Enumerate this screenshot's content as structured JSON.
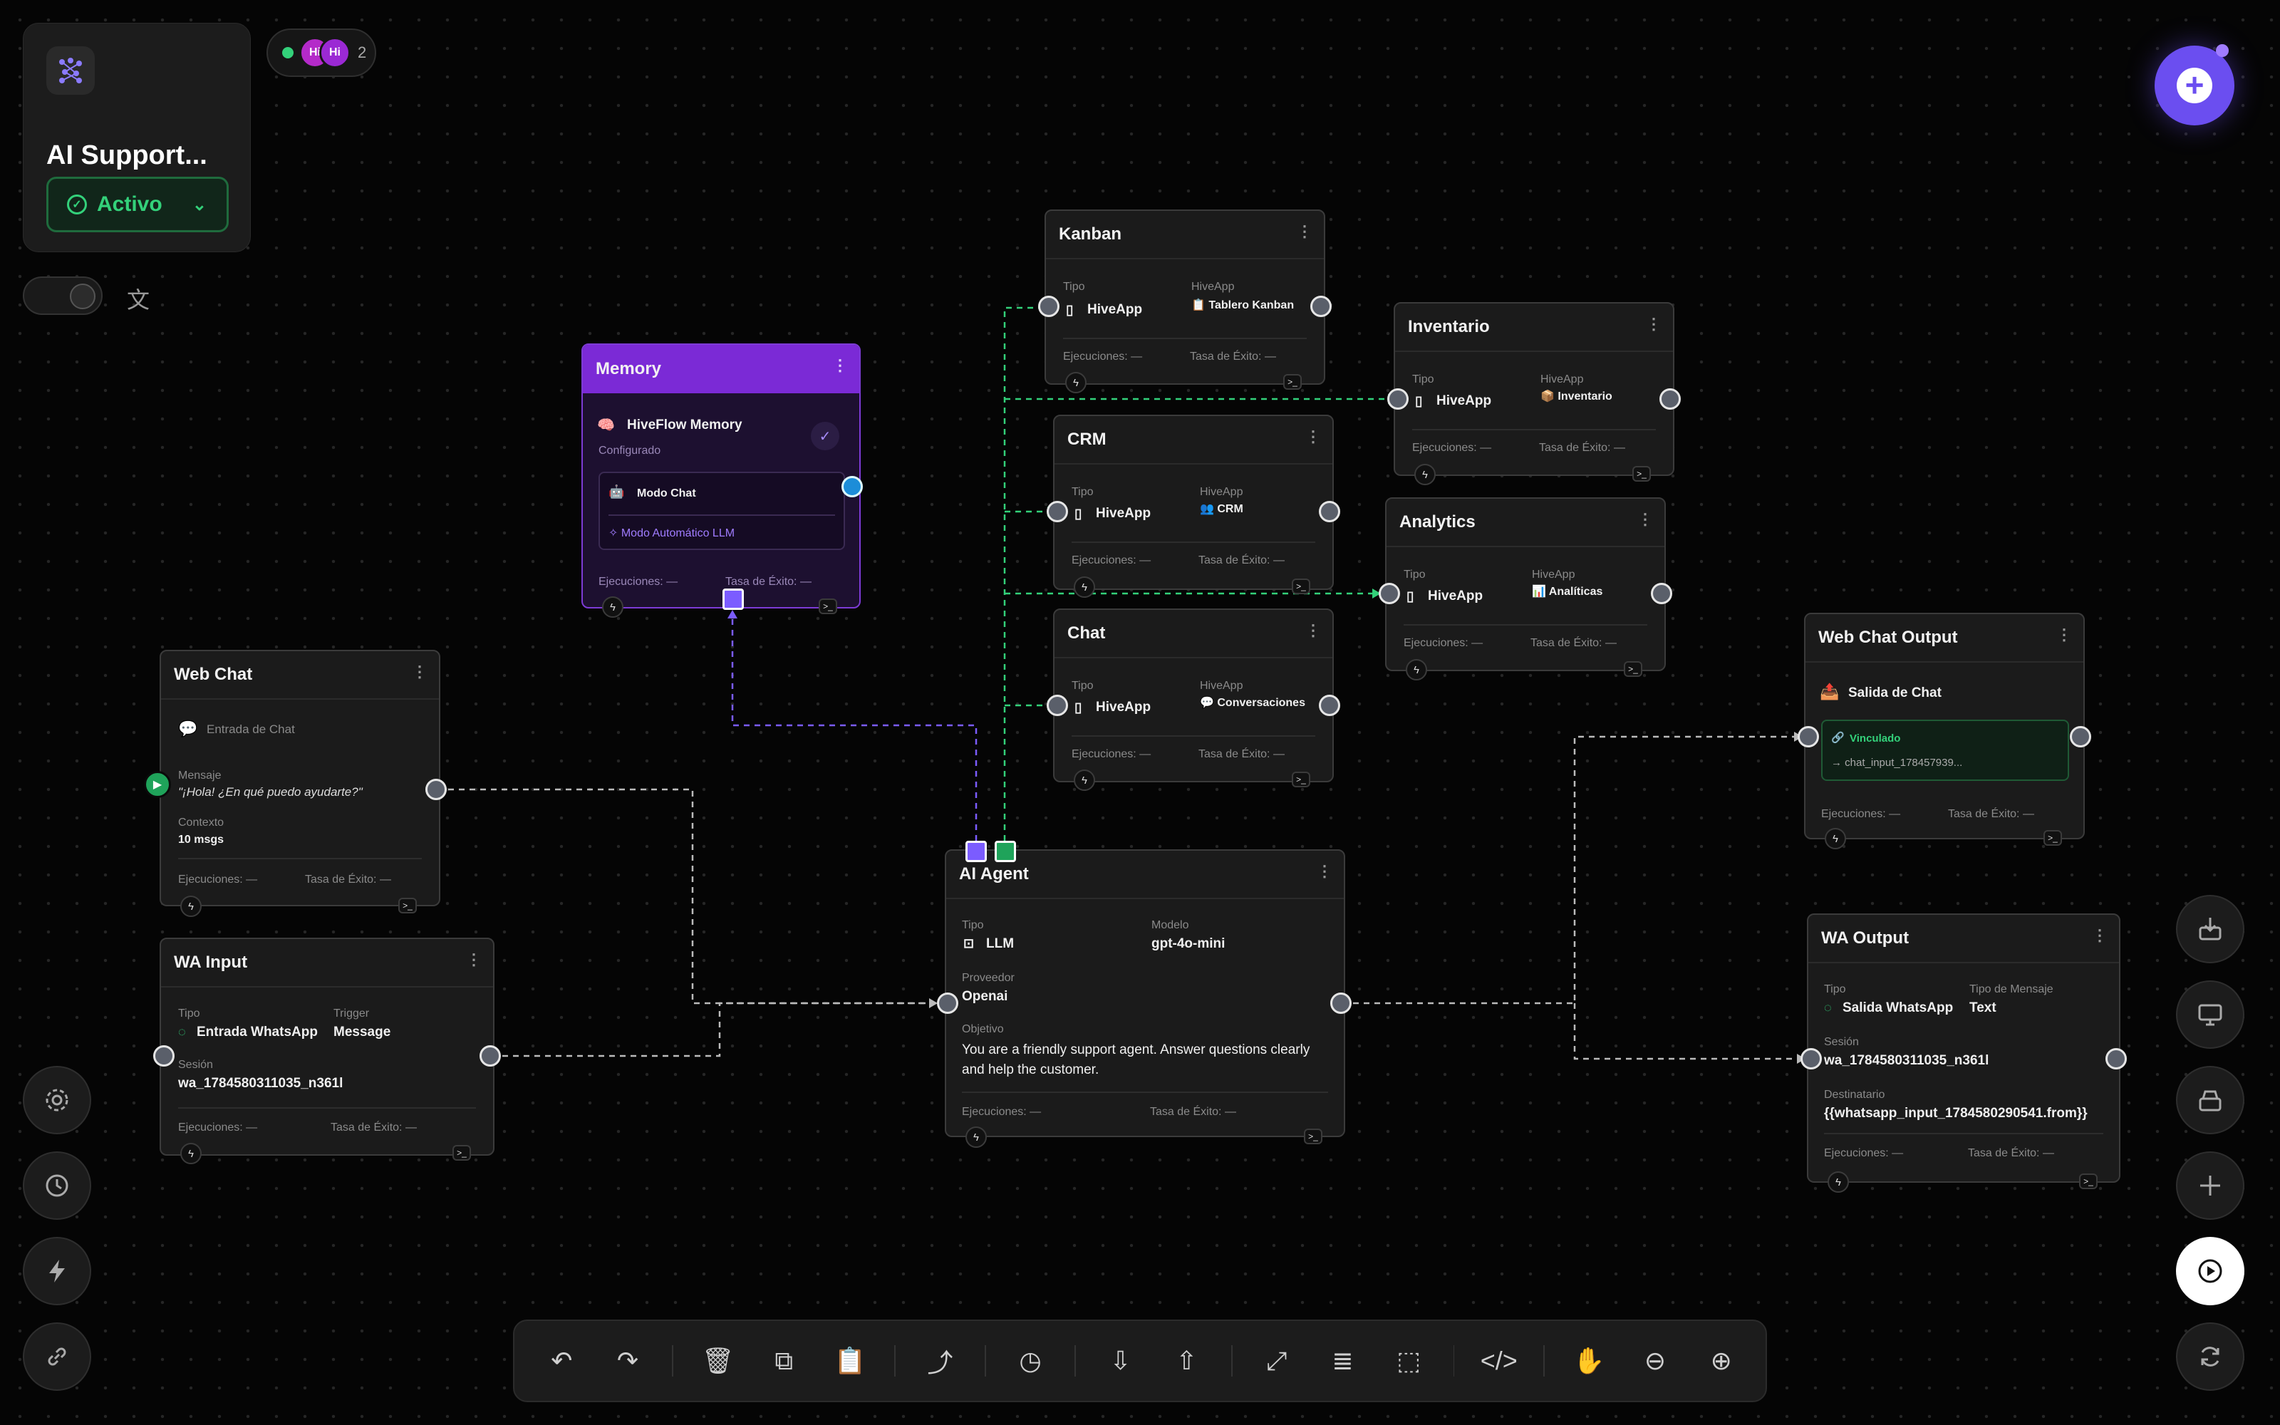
{
  "project": {
    "title": "AI Support...",
    "status": "Activo"
  },
  "presence": {
    "avatars": [
      "Hi",
      "Hi"
    ],
    "count": "2"
  },
  "nodes": {
    "kanban": {
      "title": "Kanban",
      "tipo_label": "Tipo",
      "tipo": "HiveApp",
      "app_label": "HiveApp",
      "app": "📋 Tablero Kanban",
      "exec": "Ejecuciones: —",
      "rate": "Tasa de Éxito: —"
    },
    "inventario": {
      "title": "Inventario",
      "tipo_label": "Tipo",
      "tipo": "HiveApp",
      "app_label": "HiveApp",
      "app": "📦 Inventario",
      "exec": "Ejecuciones: —",
      "rate": "Tasa de Éxito: —"
    },
    "crm": {
      "title": "CRM",
      "tipo_label": "Tipo",
      "tipo": "HiveApp",
      "app_label": "HiveApp",
      "app": "👥 CRM",
      "exec": "Ejecuciones: —",
      "rate": "Tasa de Éxito: —"
    },
    "analytics": {
      "title": "Analytics",
      "tipo_label": "Tipo",
      "tipo": "HiveApp",
      "app_label": "HiveApp",
      "app": "📊 Analíticas",
      "exec": "Ejecuciones: —",
      "rate": "Tasa de Éxito: —"
    },
    "chat": {
      "title": "Chat",
      "tipo_label": "Tipo",
      "tipo": "HiveApp",
      "app_label": "HiveApp",
      "app": "💬 Conversaciones",
      "exec": "Ejecuciones: —",
      "rate": "Tasa de Éxito: —"
    },
    "memory": {
      "title": "Memory",
      "name": "HiveFlow Memory",
      "status": "Configurado",
      "mode": "Modo Chat",
      "auto": "✧ Modo Automático LLM",
      "exec": "Ejecuciones: —",
      "rate": "Tasa de Éxito: —"
    },
    "webchat": {
      "title": "Web Chat",
      "subtitle": "Entrada de Chat",
      "msg_label": "Mensaje",
      "msg": "\"¡Hola! ¿En qué puedo ayudarte?\"",
      "ctx_label": "Contexto",
      "ctx": "10 msgs",
      "exec": "Ejecuciones: —",
      "rate": "Tasa de Éxito: —"
    },
    "wainput": {
      "title": "WA Input",
      "tipo_label": "Tipo",
      "tipo": "Entrada WhatsApp",
      "trigger_label": "Trigger",
      "trigger": "Message",
      "sesion_label": "Sesión",
      "sesion": "wa_1784580311035_n361l",
      "exec": "Ejecuciones: —",
      "rate": "Tasa de Éxito: —"
    },
    "agent": {
      "title": "AI Agent",
      "tipo_label": "Tipo",
      "tipo": "LLM",
      "modelo_label": "Modelo",
      "modelo": "gpt-4o-mini",
      "prov_label": "Proveedor",
      "prov": "Openai",
      "obj_label": "Objetivo",
      "obj": "You are a friendly support agent. Answer questions clearly and help the customer.",
      "exec": "Ejecuciones: —",
      "rate": "Tasa de Éxito: —"
    },
    "webout": {
      "title": "Web Chat Output",
      "name": "Salida de Chat",
      "linked": "Vinculado",
      "link_target": "→ chat_input_178457939...",
      "exec": "Ejecuciones: —",
      "rate": "Tasa de Éxito: —"
    },
    "waout": {
      "title": "WA Output",
      "tipo_label": "Tipo",
      "tipo": "Salida WhatsApp",
      "msgtype_label": "Tipo de Mensaje",
      "msgtype": "Text",
      "sesion_label": "Sesión",
      "sesion": "wa_1784580311035_n361l",
      "dest_label": "Destinatario",
      "dest": "{{whatsapp_input_1784580290541.from}}",
      "exec": "Ejecuciones: —",
      "rate": "Tasa de Éxito: —"
    }
  },
  "icons": {
    "left": [
      "gear-icon",
      "clock-icon",
      "bolt-icon",
      "link-icon"
    ],
    "right": [
      "import-icon",
      "monitor-icon",
      "archive-icon",
      "plus-icon",
      "play-icon",
      "refresh-icon"
    ],
    "toolbar": [
      "undo",
      "redo",
      "delete",
      "copy",
      "paste",
      "share",
      "history",
      "download",
      "upload",
      "fit-view",
      "list",
      "select",
      "code",
      "hand",
      "zoom-out",
      "zoom-in"
    ]
  },
  "colors": {
    "accent": "#6b4ef0",
    "active": "#33d17a",
    "memory": "#7b2ad6",
    "edge_green": "#33d17a",
    "edge_purple": "#7b5cff"
  }
}
